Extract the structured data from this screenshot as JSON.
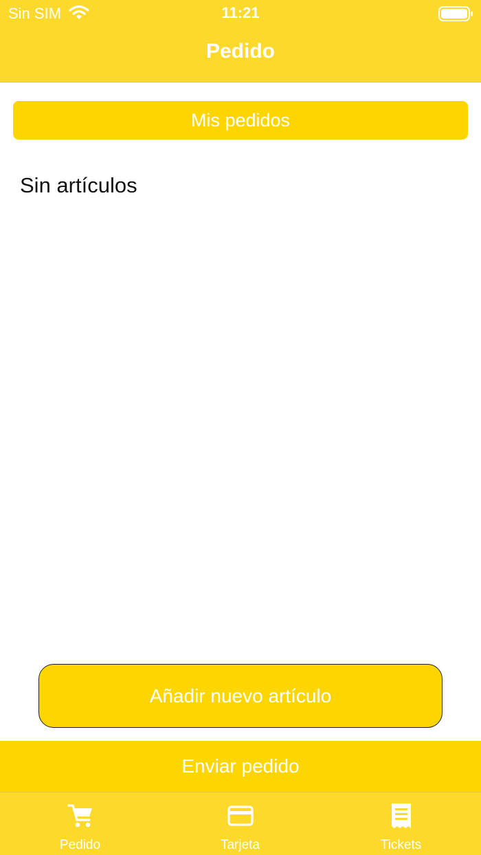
{
  "status": {
    "carrier": "Sin SIM",
    "time": "11:21",
    "wifi_icon": "wifi-icon",
    "battery_icon": "battery-icon"
  },
  "header": {
    "title": "Pedido"
  },
  "main": {
    "orders_button": "Mis pedidos",
    "empty_message": "Sin artículos",
    "add_item_button": "Añadir nuevo artículo",
    "send_order_button": "Enviar pedido"
  },
  "tabbar": {
    "tabs": [
      {
        "label": "Pedido",
        "icon": "cart-icon"
      },
      {
        "label": "Tarjeta",
        "icon": "card-icon"
      },
      {
        "label": "Tickets",
        "icon": "receipt-icon"
      }
    ]
  },
  "colors": {
    "accent": "#FDD600",
    "bar": "#FDD92C",
    "text_on_accent": "#FFFFFF"
  }
}
